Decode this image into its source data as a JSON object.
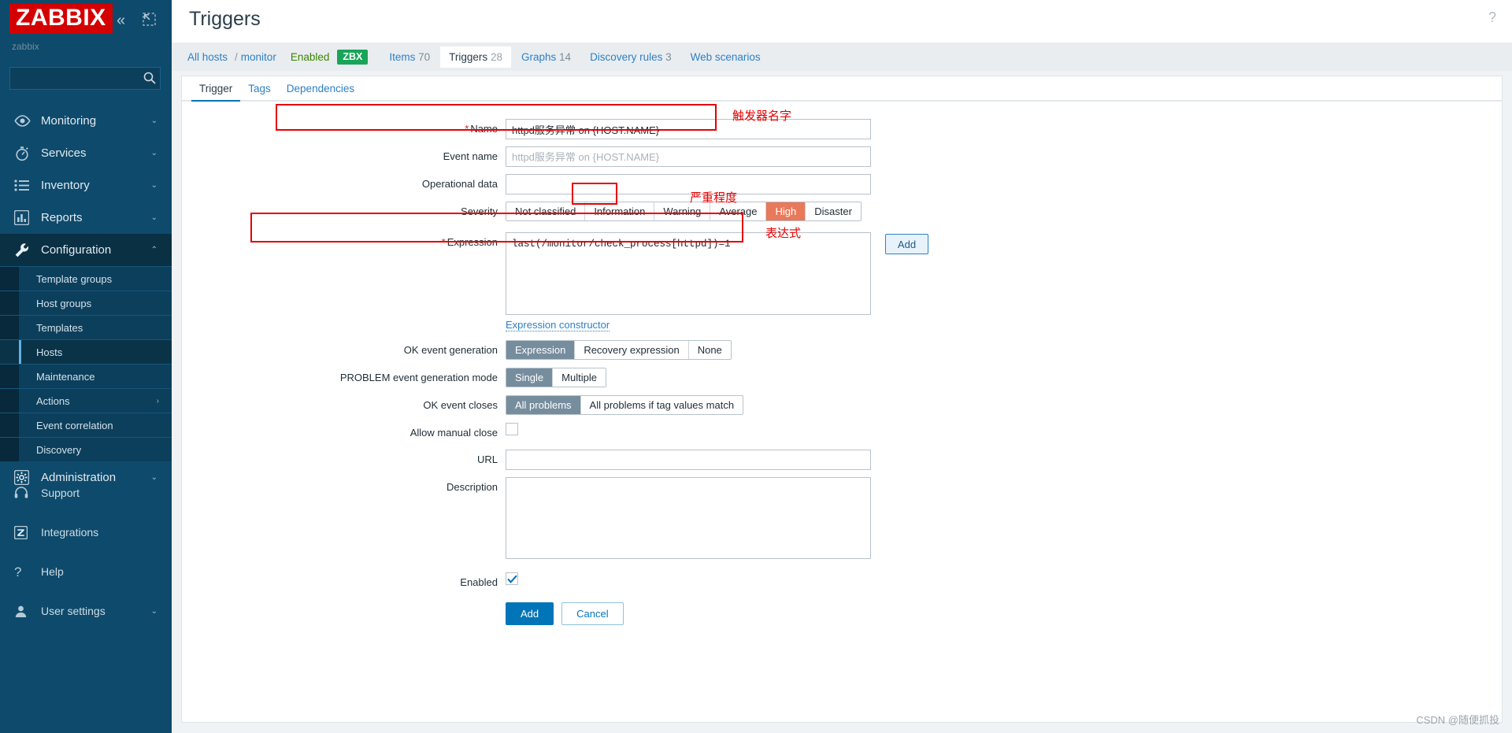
{
  "sidebar": {
    "logo": "ZABBIX",
    "subtitle": "zabbix",
    "search_placeholder": "",
    "nav": [
      {
        "label": "Monitoring",
        "icon": "eye-icon",
        "chevron": "⌄"
      },
      {
        "label": "Services",
        "icon": "stopwatch-icon",
        "chevron": "⌄"
      },
      {
        "label": "Inventory",
        "icon": "list-icon",
        "chevron": "⌄"
      },
      {
        "label": "Reports",
        "icon": "bar-chart-icon",
        "chevron": "⌄"
      },
      {
        "label": "Configuration",
        "icon": "wrench-icon",
        "chevron": "⌃"
      }
    ],
    "submenu": [
      {
        "label": "Template groups"
      },
      {
        "label": "Host groups"
      },
      {
        "label": "Templates"
      },
      {
        "label": "Hosts"
      },
      {
        "label": "Maintenance"
      },
      {
        "label": "Actions",
        "arrow": "›"
      },
      {
        "label": "Event correlation"
      },
      {
        "label": "Discovery"
      }
    ],
    "administration": {
      "label": "Administration",
      "icon": "gear-icon",
      "chevron": "⌄"
    },
    "lower": [
      {
        "label": "Support",
        "icon": "headset-icon"
      },
      {
        "label": "Integrations",
        "icon": "zabbix-z-icon"
      },
      {
        "label": "Help",
        "icon": "question-icon"
      },
      {
        "label": "User settings",
        "icon": "user-icon",
        "chevron": "⌄"
      }
    ]
  },
  "header": {
    "title": "Triggers",
    "help_icon": "?"
  },
  "breadcrumb": {
    "all_hosts": "All hosts",
    "separator": "/",
    "host": "monitor",
    "status": "Enabled",
    "zbx_badge": "ZBX",
    "tabs": [
      {
        "label": "Items",
        "count": "70",
        "active": false
      },
      {
        "label": "Triggers",
        "count": "28",
        "active": true
      },
      {
        "label": "Graphs",
        "count": "14",
        "active": false
      },
      {
        "label": "Discovery rules",
        "count": "3",
        "active": false
      },
      {
        "label": "Web scenarios",
        "count": "",
        "active": false
      }
    ]
  },
  "tabs": [
    {
      "label": "Trigger",
      "active": true
    },
    {
      "label": "Tags",
      "active": false
    },
    {
      "label": "Dependencies",
      "active": false
    }
  ],
  "form": {
    "name": {
      "label": "Name",
      "required": true,
      "value": "httpd服务异常 on {HOST.NAME}"
    },
    "event_name": {
      "label": "Event name",
      "value": "",
      "placeholder": "httpd服务异常 on {HOST.NAME}"
    },
    "operational_data": {
      "label": "Operational data",
      "value": "",
      "placeholder": ""
    },
    "severity": {
      "label": "Severity",
      "options": [
        "Not classified",
        "Information",
        "Warning",
        "Average",
        "High",
        "Disaster"
      ],
      "selected": "High"
    },
    "expression": {
      "label": "Expression",
      "required": true,
      "value": "last(/monitor/check_process[httpd])=1",
      "add_button": "Add",
      "constructor_link": "Expression constructor"
    },
    "ok_event_generation": {
      "label": "OK event generation",
      "options": [
        "Expression",
        "Recovery expression",
        "None"
      ],
      "selected": "Expression"
    },
    "problem_event_mode": {
      "label": "PROBLEM event generation mode",
      "options": [
        "Single",
        "Multiple"
      ],
      "selected": "Single"
    },
    "ok_event_closes": {
      "label": "OK event closes",
      "options": [
        "All problems",
        "All problems if tag values match"
      ],
      "selected": "All problems"
    },
    "allow_manual_close": {
      "label": "Allow manual close",
      "checked": false
    },
    "url": {
      "label": "URL",
      "value": ""
    },
    "description": {
      "label": "Description",
      "value": ""
    },
    "enabled": {
      "label": "Enabled",
      "checked": true
    },
    "submit": "Add",
    "cancel": "Cancel"
  },
  "annotations": {
    "name": "触发器名字",
    "severity": "严重程度",
    "expression": "表达式"
  },
  "watermark": "CSDN @随便抓投",
  "colors": {
    "brand_red": "#d40000",
    "sidebar": "#0e4a6b",
    "accent_blue": "#0275b8",
    "severity_high": "#e8795a",
    "zbx_green": "#18a558",
    "annotation_red": "#e60000"
  }
}
